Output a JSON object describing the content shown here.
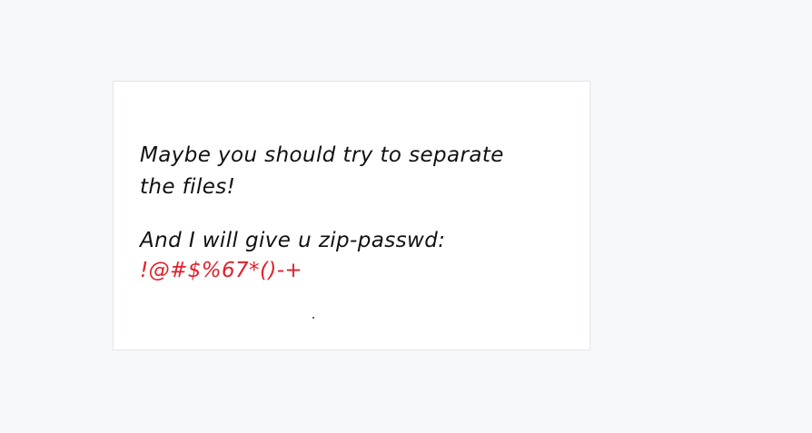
{
  "message": {
    "line1": "Maybe you should try to separate",
    "line2": "the files!",
    "line3": "And I will give u zip-passwd:",
    "password": "!@#$%67*()-+"
  },
  "colors": {
    "background": "#f7f8fc",
    "card": "#ffffff",
    "text": "#111111",
    "password": "#e0202b"
  }
}
